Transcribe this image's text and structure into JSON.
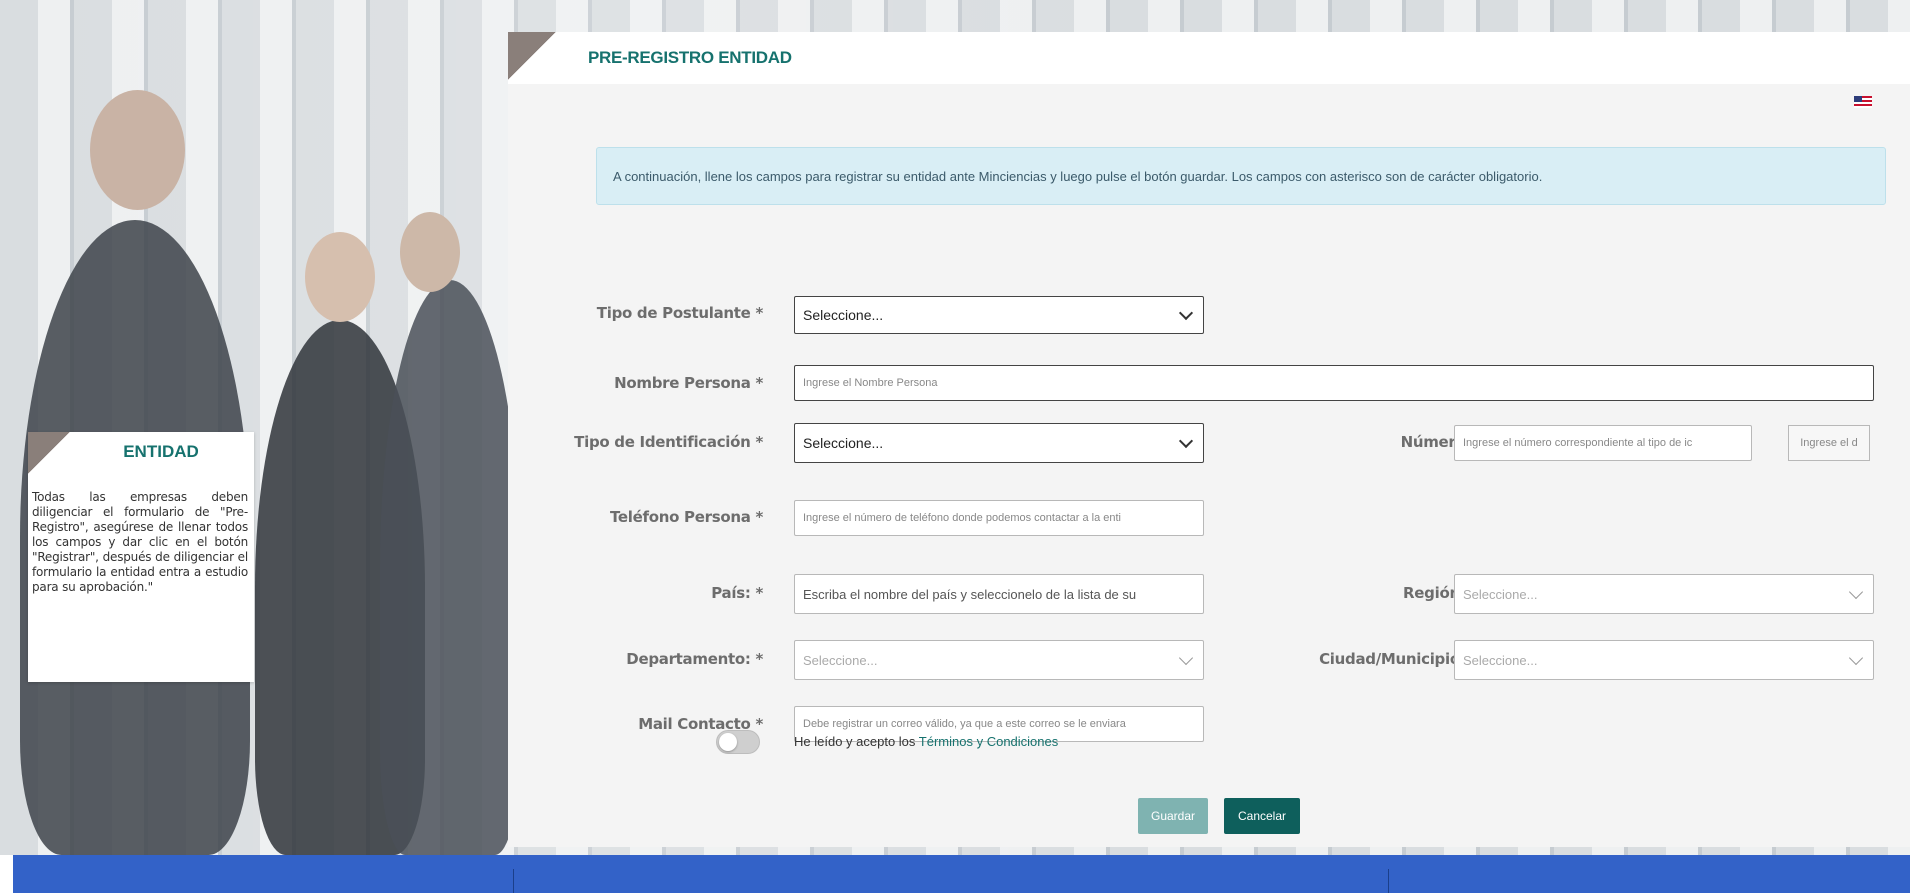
{
  "header": {
    "title": "PRE-REGISTRO ENTIDAD",
    "flag": "us-flag-icon"
  },
  "info": "A continuación, llene los campos para registrar su entidad ante Minciencias y luego pulse el botón guardar. Los campos con asterisco son de carácter obligatorio.",
  "form": {
    "tipo_postulante": {
      "label": "Tipo de Postulante *",
      "value": "Seleccione..."
    },
    "nombre_persona": {
      "label": "Nombre Persona *",
      "placeholder": "Ingrese el Nombre Persona"
    },
    "tipo_identificacion": {
      "label": "Tipo de Identificación *",
      "value": "Seleccione..."
    },
    "numero": {
      "label": "Número *",
      "placeholder": "Ingrese el número correspondiente al tipo de ic",
      "extra": "Ingrese el d"
    },
    "telefono": {
      "label": "Teléfono Persona *",
      "placeholder": "Ingrese el número de teléfono donde podemos contactar a la enti"
    },
    "pais": {
      "label": "País: *",
      "placeholder": "Escriba el nombre del país y seleccionelo de la lista de su"
    },
    "region": {
      "label": "Región: *",
      "value": "Seleccione..."
    },
    "departamento": {
      "label": "Departamento: *",
      "value": "Seleccione..."
    },
    "ciudad": {
      "label": "Ciudad/Municipio: *",
      "value": "Seleccione..."
    },
    "mail": {
      "label": "Mail Contacto *",
      "placeholder": "Debe registrar un correo válido, ya que a este correo se le enviara"
    },
    "terms_prefix": "He leído y acepto los ",
    "terms_link": "Términos y Condiciones"
  },
  "buttons": {
    "save": "Guardar",
    "cancel": "Cancelar"
  },
  "side": {
    "title": "ENTIDAD",
    "text": "Todas las empresas deben diligenciar el formulario de \"Pre-Registro\", asegúrese de llenar todos los campos y dar clic en el botón \"Registrar\", después de diligenciar el formulario la entidad entra a estudio para su aprobación.\""
  },
  "colors": {
    "accent": "#16726e",
    "footer": "#3362c8",
    "cancel": "#0e5f5c",
    "save": "#7fb3b1"
  }
}
